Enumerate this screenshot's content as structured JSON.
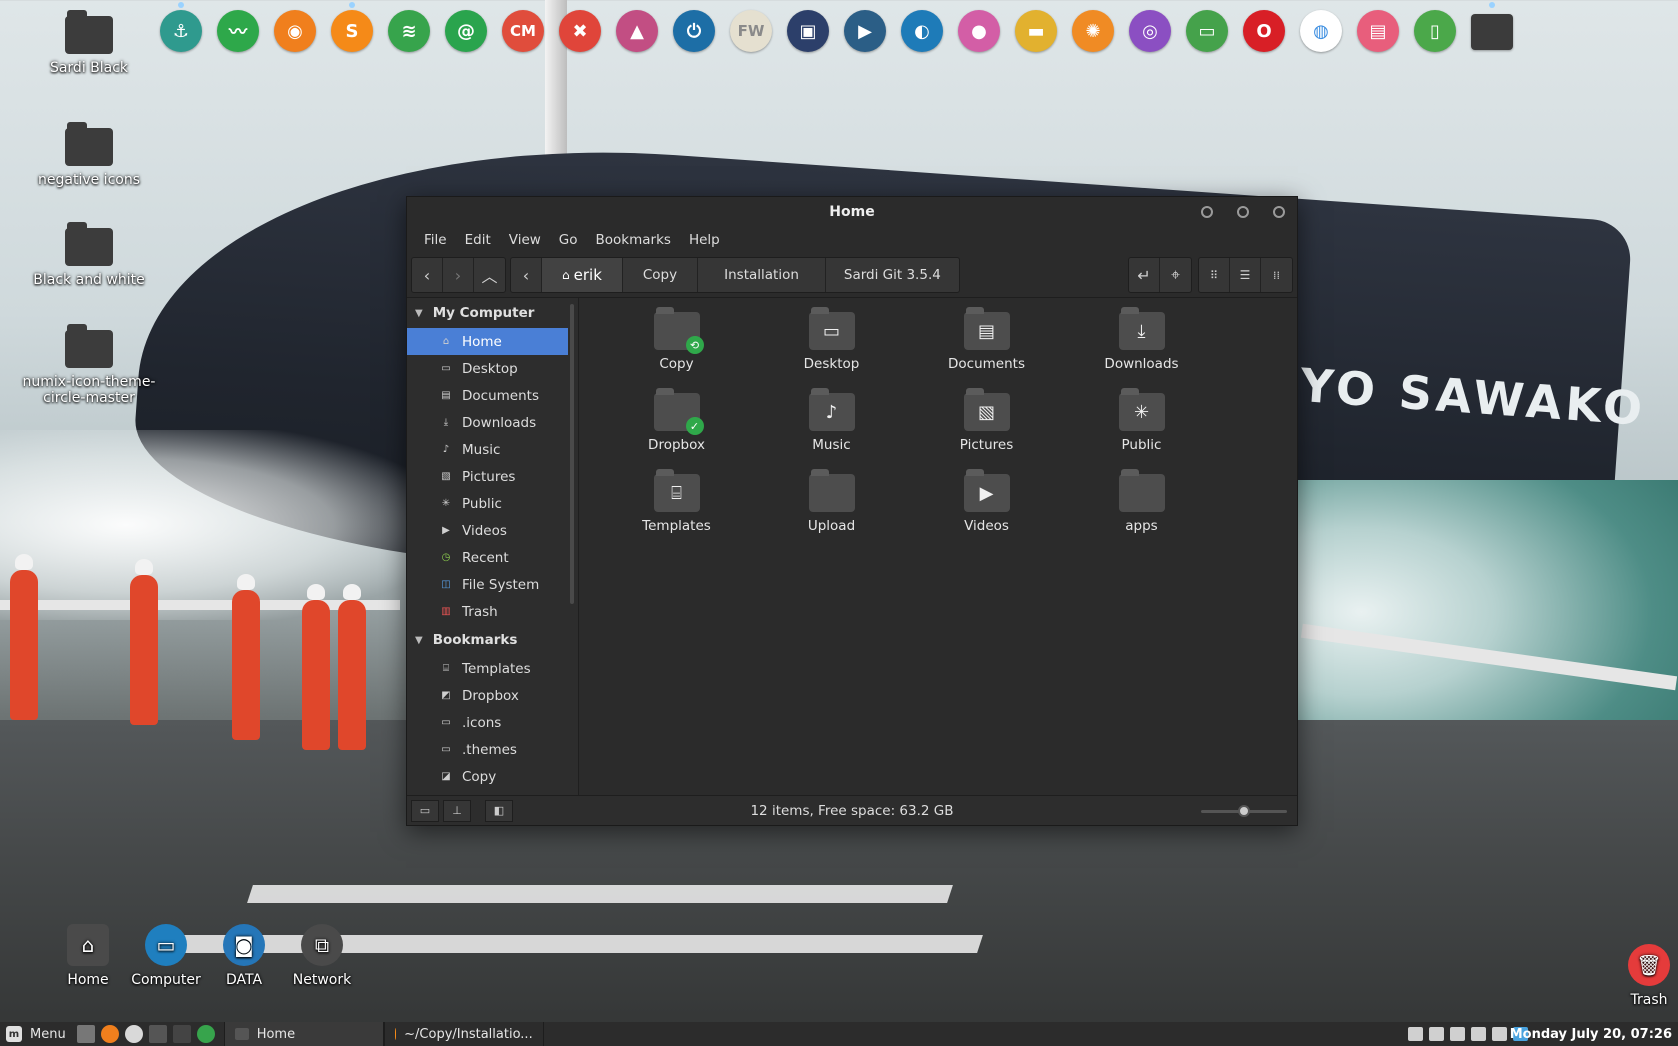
{
  "desktop": {
    "top_left_icons": [
      {
        "label": "Sardi Black"
      },
      {
        "label": "negative icons"
      },
      {
        "label": "Black and white"
      },
      {
        "label": "numix-icon-theme-circle-master"
      }
    ],
    "bottom_icons": [
      {
        "label": "Home"
      },
      {
        "label": "Computer"
      },
      {
        "label": "DATA"
      },
      {
        "label": "Network"
      }
    ],
    "trash_label": "Trash"
  },
  "dock": {
    "icons": [
      {
        "name": "anchor",
        "color": "#2f9a8e",
        "glyph": "⚓"
      },
      {
        "name": "system-monitor",
        "color": "#2ea84a",
        "glyph": "〰"
      },
      {
        "name": "firefox",
        "color": "#f07f1d",
        "glyph": "◉"
      },
      {
        "name": "sublime",
        "color": "#f58a18",
        "glyph": "S"
      },
      {
        "name": "spotify",
        "color": "#37a44c",
        "glyph": "≋"
      },
      {
        "name": "mail",
        "color": "#2aa44d",
        "glyph": "@"
      },
      {
        "name": "cm",
        "color": "#e04d3c",
        "glyph": "CM"
      },
      {
        "name": "tools",
        "color": "#e0453a",
        "glyph": "✖"
      },
      {
        "name": "inkscape",
        "color": "#c24e83",
        "glyph": "▲"
      },
      {
        "name": "power",
        "color": "#1d6ea6",
        "glyph": "⏻"
      },
      {
        "name": "fw",
        "color": "#e5e0d0",
        "glyph": "FW"
      },
      {
        "name": "screenshot",
        "color": "#2c3f6a",
        "glyph": "▣"
      },
      {
        "name": "video-editor",
        "color": "#2b5e86",
        "glyph": "▶"
      },
      {
        "name": "pidgin",
        "color": "#1e7bb8",
        "glyph": "◐"
      },
      {
        "name": "camera",
        "color": "#d35ea6",
        "glyph": "●"
      },
      {
        "name": "ruler",
        "color": "#e2b12f",
        "glyph": "▬"
      },
      {
        "name": "pinwheel",
        "color": "#f08b24",
        "glyph": "✺"
      },
      {
        "name": "disk",
        "color": "#8b4fc2",
        "glyph": "◎"
      },
      {
        "name": "card",
        "color": "#45a24b",
        "glyph": "▭"
      },
      {
        "name": "opera",
        "color": "#d81f26",
        "glyph": "O"
      },
      {
        "name": "chrome",
        "color": "#ffffff",
        "glyph": "◍"
      },
      {
        "name": "printer",
        "color": "#e85e7c",
        "glyph": "▤"
      },
      {
        "name": "book",
        "color": "#4ba84a",
        "glyph": "▯"
      },
      {
        "name": "folder",
        "color": "#3b3b3b",
        "glyph": ""
      }
    ]
  },
  "window": {
    "title": "Home",
    "menu": [
      "File",
      "Edit",
      "View",
      "Go",
      "Bookmarks",
      "Help"
    ],
    "breadcrumbs": [
      {
        "label": "erik",
        "active": true
      },
      {
        "label": "Copy",
        "active": false
      },
      {
        "label": "Installation",
        "active": false
      },
      {
        "label": "Sardi Git 3.5.4",
        "active": false
      }
    ],
    "sidebar": {
      "computer_heading": "My Computer",
      "computer_items": [
        {
          "label": "Home",
          "icon": "home-icon",
          "selected": true
        },
        {
          "label": "Desktop",
          "icon": "desktop-icon"
        },
        {
          "label": "Documents",
          "icon": "documents-icon"
        },
        {
          "label": "Downloads",
          "icon": "downloads-icon"
        },
        {
          "label": "Music",
          "icon": "music-icon"
        },
        {
          "label": "Pictures",
          "icon": "pictures-icon"
        },
        {
          "label": "Public",
          "icon": "public-icon"
        },
        {
          "label": "Videos",
          "icon": "videos-icon"
        },
        {
          "label": "Recent",
          "icon": "recent-icon"
        },
        {
          "label": "File System",
          "icon": "filesystem-icon"
        },
        {
          "label": "Trash",
          "icon": "trash-icon"
        }
      ],
      "bookmarks_heading": "Bookmarks",
      "bookmark_items": [
        {
          "label": "Templates",
          "icon": "templates-icon"
        },
        {
          "label": "Dropbox",
          "icon": "dropbox-icon"
        },
        {
          "label": ".icons",
          "icon": "folder-icon"
        },
        {
          "label": ".themes",
          "icon": "folder-icon"
        },
        {
          "label": "Copy",
          "icon": "copy-folder-icon"
        }
      ]
    },
    "files": [
      {
        "label": "Copy",
        "glyph": "",
        "badge": "⟲",
        "badge_color": "#2fa84a"
      },
      {
        "label": "Desktop",
        "glyph": "▭",
        "badge": "",
        "badge_color": ""
      },
      {
        "label": "Documents",
        "glyph": "▤",
        "badge": "",
        "badge_color": ""
      },
      {
        "label": "Downloads",
        "glyph": "⤓",
        "badge": "",
        "badge_color": ""
      },
      {
        "label": "Dropbox",
        "glyph": "",
        "badge": "✓",
        "badge_color": "#2fa84a"
      },
      {
        "label": "Music",
        "glyph": "♪",
        "badge": "",
        "badge_color": ""
      },
      {
        "label": "Pictures",
        "glyph": "▧",
        "badge": "",
        "badge_color": ""
      },
      {
        "label": "Public",
        "glyph": "✳",
        "badge": "",
        "badge_color": ""
      },
      {
        "label": "Templates",
        "glyph": "⌸",
        "badge": "",
        "badge_color": ""
      },
      {
        "label": "Upload",
        "glyph": "",
        "badge": "",
        "badge_color": ""
      },
      {
        "label": "Videos",
        "glyph": "▶",
        "badge": "",
        "badge_color": ""
      },
      {
        "label": "apps",
        "glyph": "",
        "badge": "",
        "badge_color": ""
      }
    ],
    "status": "12 items, Free space: 63.2 GB",
    "zoom_level": 0.5
  },
  "taskbar": {
    "menu_label": "Menu",
    "windows": [
      {
        "label": "Home"
      },
      {
        "label": "~/Copy/Installatio..."
      }
    ],
    "clock": "Monday July 20, 07:26"
  }
}
